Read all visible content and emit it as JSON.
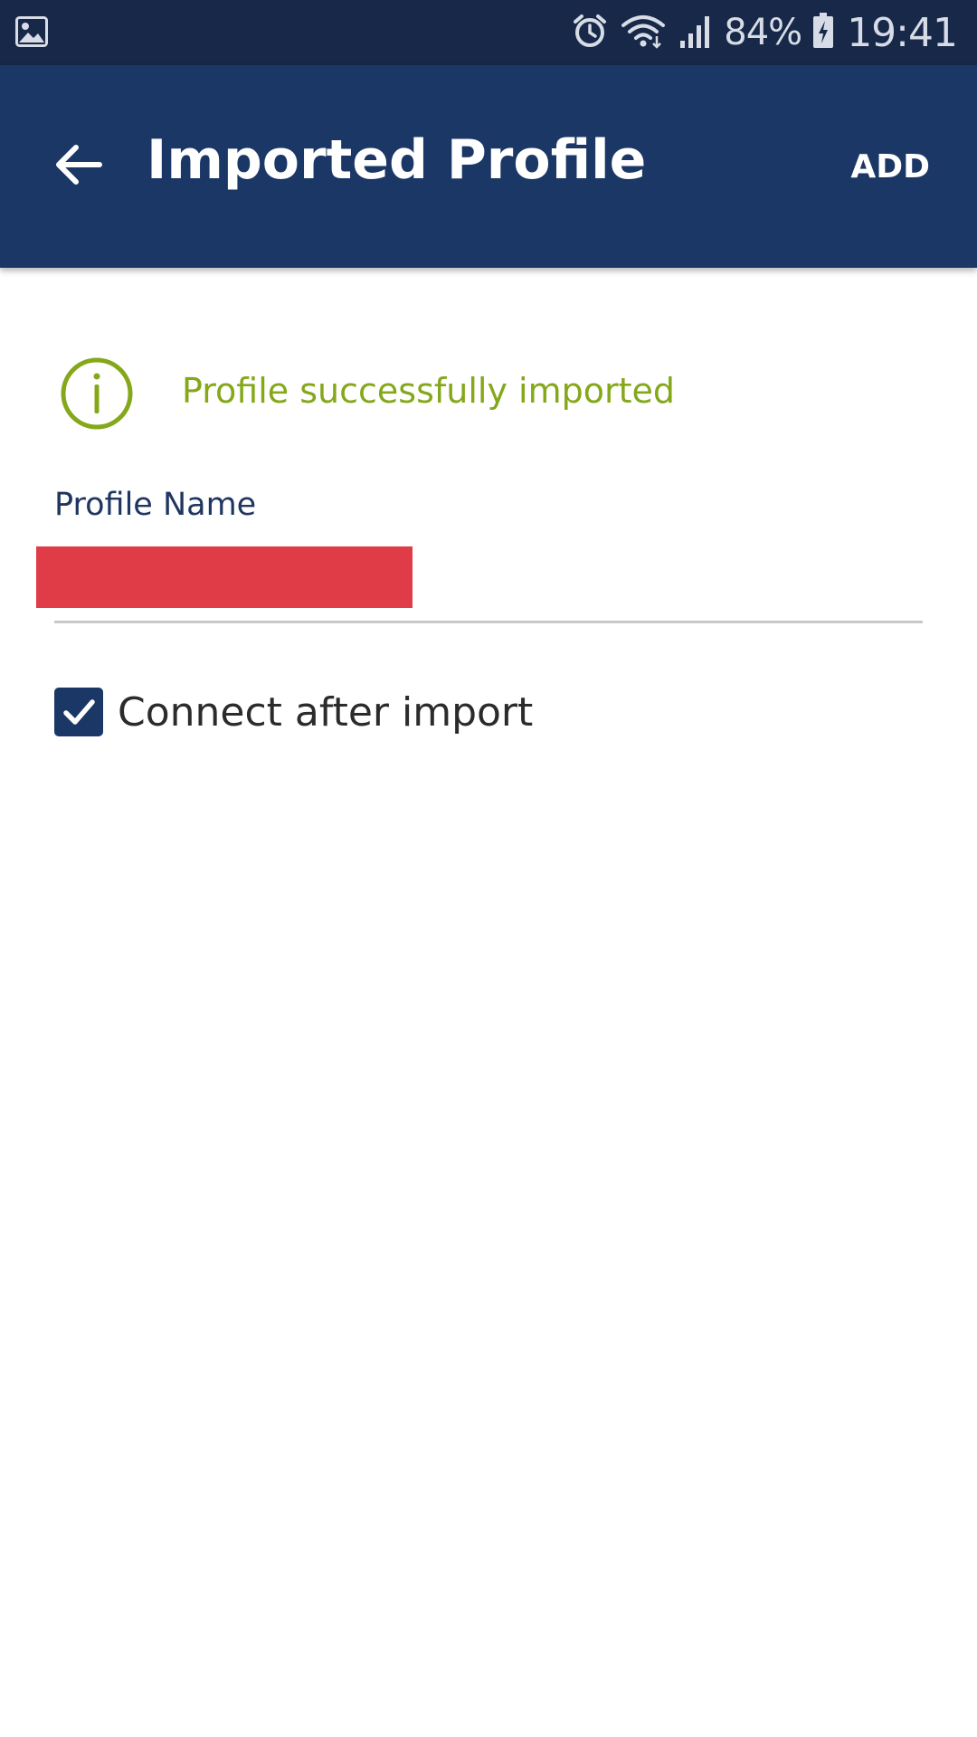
{
  "status_bar": {
    "battery_percent": "84%",
    "time": "19:41",
    "icons": [
      "gallery-icon",
      "alarm-icon",
      "wifi-icon",
      "signal-icon",
      "battery-charging-icon"
    ]
  },
  "app_bar": {
    "title": "Imported Profile",
    "action_label": "ADD",
    "background_color": "#1b3766"
  },
  "notice": {
    "icon": "info-icon",
    "text": "Profile successfully imported",
    "color": "#84a81a"
  },
  "form": {
    "profile_name_label": "Profile Name",
    "profile_name_value": "",
    "connect_after_import": {
      "label": "Connect after import",
      "checked": true
    }
  }
}
